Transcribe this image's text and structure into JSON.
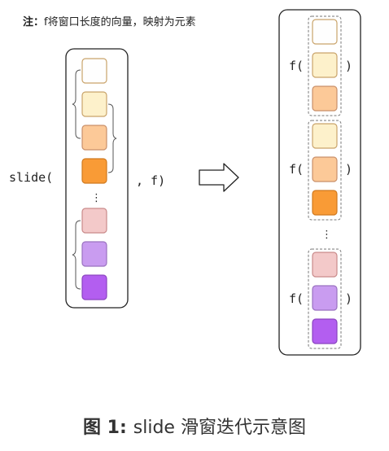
{
  "note": {
    "label": "注：",
    "text": "f将窗口长度的向量，映射为元素"
  },
  "left_panel": {
    "call_prefix": "slide(",
    "call_suffix": ", f)",
    "ellipsis": "⋮"
  },
  "right_panel": {
    "func_open": "f(",
    "func_close": ")",
    "ellipsis": "⋮"
  },
  "caption": {
    "label": "图 1:",
    "text": "slide 滑窗迭代示意图"
  },
  "colors": {
    "cell_1": "#fefefe",
    "cell_2": "#fdf1cb",
    "cell_3": "#fcc998",
    "cell_4": "#f99b36",
    "cell_5": "#f3c9c9",
    "cell_6": "#c99cf0",
    "cell_7": "#b35ef0"
  }
}
